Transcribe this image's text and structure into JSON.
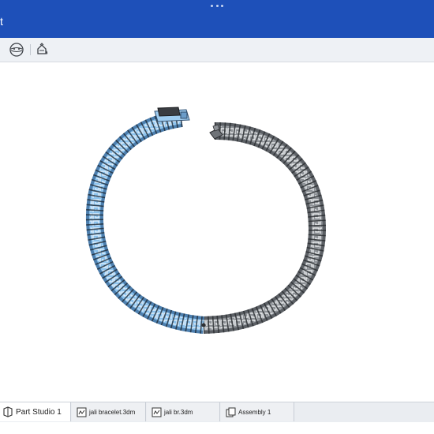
{
  "window": {
    "title_fragment": "t"
  },
  "toolbar": {
    "icons": [
      "view-orientation-icon",
      "appearance-paint-icon"
    ]
  },
  "tabs": [
    {
      "label": "Part Studio 1",
      "icon": "part-studio-icon",
      "active": true
    },
    {
      "label": "jali bracelet.3dm",
      "icon": "imported-part-icon",
      "active": false
    },
    {
      "label": "jali br.3dm",
      "icon": "imported-part-icon",
      "active": false
    },
    {
      "label": "Assembly 1",
      "icon": "assembly-icon",
      "active": false
    }
  ],
  "colors": {
    "header": "#1e50b9",
    "selection_highlight": "#8cc3ee",
    "model_metal": "#6f7378"
  }
}
